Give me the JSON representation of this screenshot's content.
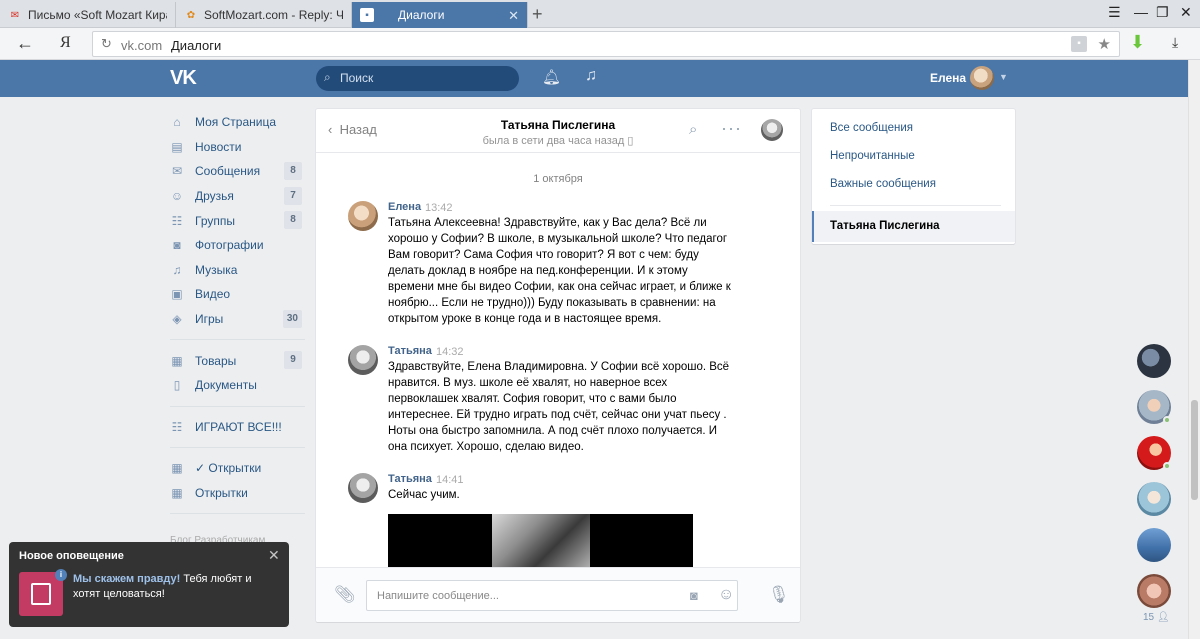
{
  "browser": {
    "tabs": [
      {
        "label": "Письмо «Soft Mozart Кира S",
        "icon": "gmail-icon"
      },
      {
        "label": "SoftMozart.com - Reply: Ча",
        "icon": "softmozart-icon"
      },
      {
        "label": "Диалоги",
        "icon": "vk-messages-icon"
      }
    ],
    "address": {
      "domain": "vk.com",
      "title": "Диалоги"
    }
  },
  "vk_header": {
    "logo": "VK",
    "search_placeholder": "Поиск",
    "user_name": "Елена"
  },
  "left_menu": {
    "items": [
      {
        "label": "Моя Страница",
        "icon": "home-icon",
        "badge": ""
      },
      {
        "label": "Новости",
        "icon": "news-icon",
        "badge": ""
      },
      {
        "label": "Сообщения",
        "icon": "messages-icon",
        "badge": "8"
      },
      {
        "label": "Друзья",
        "icon": "friends-icon",
        "badge": "7"
      },
      {
        "label": "Группы",
        "icon": "groups-icon",
        "badge": "8"
      },
      {
        "label": "Фотографии",
        "icon": "camera-icon",
        "badge": ""
      },
      {
        "label": "Музыка",
        "icon": "music-icon",
        "badge": ""
      },
      {
        "label": "Видео",
        "icon": "video-icon",
        "badge": ""
      },
      {
        "label": "Игры",
        "icon": "games-icon",
        "badge": "30"
      }
    ],
    "items2": [
      {
        "label": "Товары",
        "icon": "bag-icon",
        "badge": "9"
      },
      {
        "label": "Документы",
        "icon": "document-icon",
        "badge": ""
      }
    ],
    "items3": [
      {
        "label": "ИГРАЮТ ВСЕ!!!",
        "icon": "group-icon",
        "badge": ""
      }
    ],
    "items4": [
      {
        "label": "✓ Открытки",
        "icon": "apps-icon",
        "badge": ""
      },
      {
        "label": "Открытки",
        "icon": "apps-icon",
        "badge": ""
      }
    ],
    "footer": "Блог  Разработчикам"
  },
  "dialog": {
    "back_label": "Назад",
    "peer_name": "Татьяна Пислегина",
    "peer_status": "была в сети два часа назад",
    "date_separator": "1 октября",
    "messages": [
      {
        "author": "Елена",
        "time": "13:42",
        "text": "Татьяна Алексеевна! Здравствуйте, как у Вас дела? Всё ли хорошо у Софии? В школе, в музыкальной школе? Что педагог Вам говорит? Сама София что говорит? Я вот с чем: буду делать доклад в ноябре на пед.конференции. И к этому времени мне бы видео Софии, как она сейчас играет, и ближе к ноябрю... Если не трудно))) Буду показывать в сравнении: на открытом уроке в конце года и в настоящее время."
      },
      {
        "author": "Татьяна",
        "time": "14:32",
        "text": "Здравствуйте, Елена Владимировна. У Софии всё хорошо. Всё нравится. В муз. школе её хвалят, но наверное всех первоклашек хвалят. София говорит, что с вами было интереснее. Ей трудно играть под счёт, сейчас они учат пьесу . Ноты она быстро запомнила. А под счёт плохо получается. И она психует. Хорошо, сделаю видео."
      },
      {
        "author": "Татьяна",
        "time": "14:41",
        "text": "Сейчас учим."
      }
    ],
    "composer_placeholder": "Напишите сообщение..."
  },
  "filters": {
    "items": [
      "Все сообщения",
      "Непрочитанные",
      "Важные сообщения"
    ],
    "active": "Татьяна Пислегина"
  },
  "chat_column": {
    "count": "15"
  },
  "notification": {
    "title": "Новое оповещение",
    "link": "Мы скажем правду!",
    "text": " Тебя любят и хотят целоваться!"
  }
}
